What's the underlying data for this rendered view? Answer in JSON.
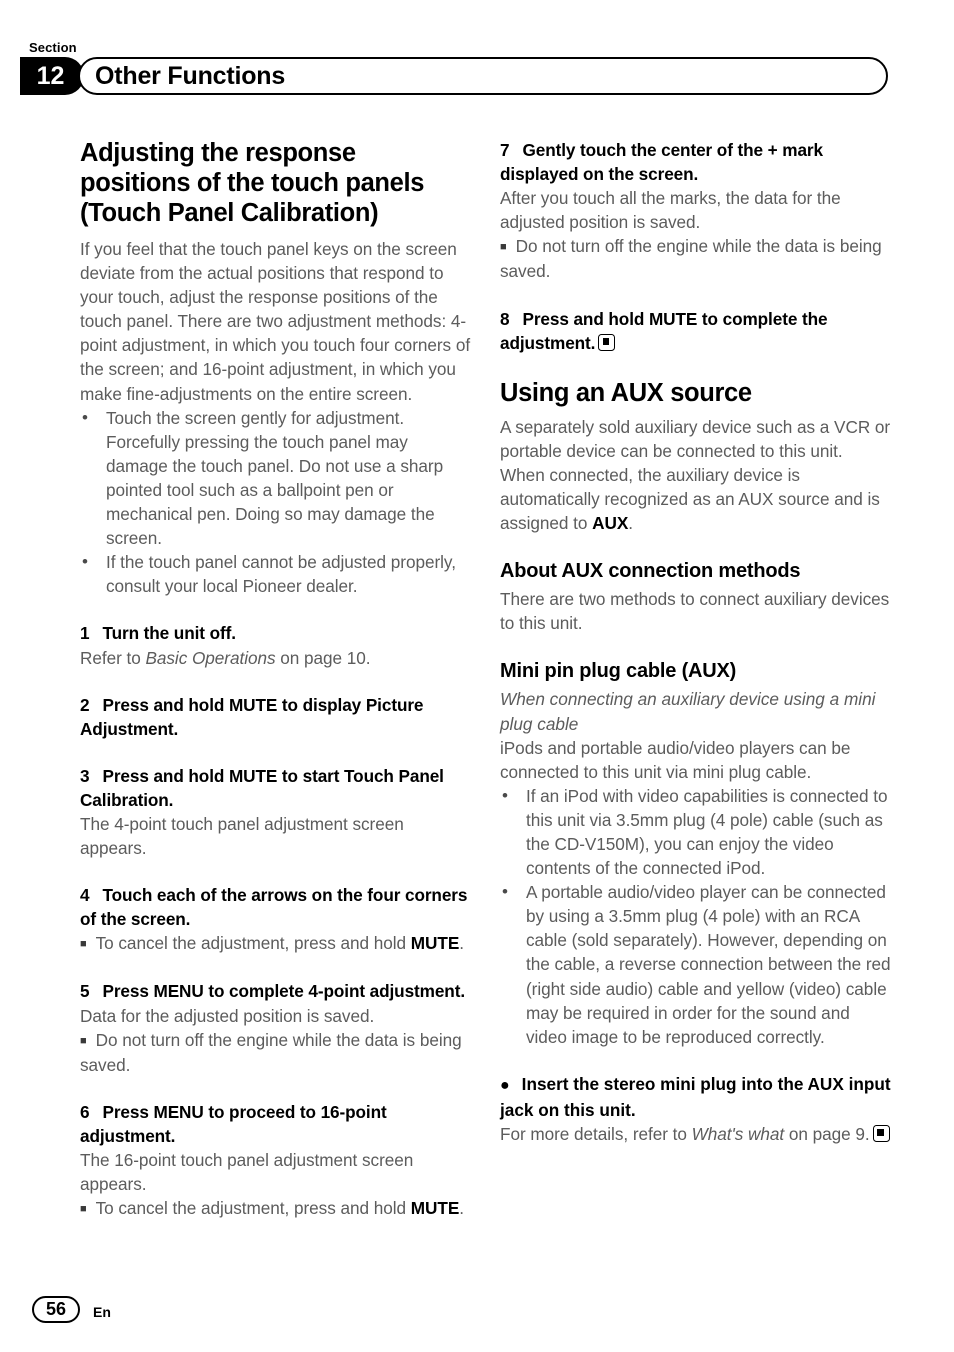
{
  "header": {
    "section_label": "Section",
    "section_number": "12",
    "section_title": "Other Functions"
  },
  "left_column": {
    "title": "Adjusting the response positions of the touch panels (Touch Panel Calibration)",
    "intro": "If you feel that the touch panel keys on the screen deviate from the actual positions that respond to your touch, adjust the response positions of the touch panel. There are two adjustment methods: 4-point adjustment, in which you touch four corners of the screen; and 16-point adjustment, in which you make fine-adjustments on the entire screen.",
    "bullets": [
      "Touch the screen gently for adjustment. Forcefully pressing the touch panel may damage the touch panel. Do not use a sharp pointed tool such as a ballpoint pen or mechanical pen. Doing so may damage the screen.",
      "If the touch panel cannot be adjusted properly, consult your local Pioneer dealer."
    ],
    "steps": [
      {
        "num": "1",
        "text": "Turn the unit off.",
        "body_pre": "Refer to ",
        "body_italic": "Basic Operations",
        "body_post": " on page 10."
      },
      {
        "num": "2",
        "text": "Press and hold MUTE to display Picture Adjustment."
      },
      {
        "num": "3",
        "text": "Press and hold MUTE to start Touch Panel Calibration.",
        "body": "The 4-point touch panel adjustment screen appears."
      },
      {
        "num": "4",
        "text": "Touch each of the arrows on the four corners of the screen.",
        "note_pre": "To cancel the adjustment, press and hold ",
        "note_bold": "MUTE",
        "note_post": "."
      },
      {
        "num": "5",
        "text": "Press MENU to complete 4-point adjustment.",
        "body": "Data for the adjusted position is saved.",
        "note": "Do not turn off the engine while the data is being saved."
      },
      {
        "num": "6",
        "text": "Press MENU to proceed to 16-point adjustment.",
        "body": "The 16-point touch panel adjustment screen appears.",
        "note_pre": "To cancel the adjustment, press and hold ",
        "note_bold": "MUTE",
        "note_post": "."
      }
    ]
  },
  "right_column": {
    "steps": [
      {
        "num": "7",
        "text": "Gently touch the center of the + mark displayed on the screen.",
        "body": "After you touch all the marks, the data for the adjusted position is saved.",
        "note": "Do not turn off the engine while the data is being saved."
      },
      {
        "num": "8",
        "text": "Press and hold MUTE to complete the adjustment."
      }
    ],
    "aux_title": "Using an AUX source",
    "aux_body_pre": "A separately sold auxiliary device such as a VCR or portable device can be connected to this unit. When connected, the auxiliary device is automatically recognized as an AUX source and is assigned to ",
    "aux_body_bold": "AUX",
    "aux_body_post": ".",
    "about_title": "About AUX connection methods",
    "about_body": "There are two methods to connect auxiliary devices to this unit.",
    "mini_title_main": "Mini pin plug cable ",
    "mini_title_aux": "(AUX)",
    "mini_italic": "When connecting an auxiliary device using a mini plug cable",
    "mini_body": "iPods and portable audio/video players can be connected to this unit via mini plug cable.",
    "mini_bullets": [
      "If an iPod with video capabilities is connected to this unit via 3.5mm plug (4 pole) cable (such as the CD-V150M), you can enjoy the video contents of the connected iPod.",
      "A portable audio/video player can be connected by using a 3.5mm plug (4 pole) with an RCA cable (sold separately). However, depending on the cable, a reverse connection between the red (right side audio) cable and yellow (video) cable may be required in order for the sound and video image to be reproduced correctly."
    ],
    "insert_step": "Insert the stereo mini plug into the AUX input jack on this unit.",
    "insert_body_pre": "For more details, refer to ",
    "insert_body_italic": "What's what",
    "insert_body_post": " on page 9."
  },
  "footer": {
    "page_number": "56",
    "language": "En"
  },
  "markers": {
    "round_bullet": "●",
    "square_note": "■",
    "dot_lead": "●"
  }
}
